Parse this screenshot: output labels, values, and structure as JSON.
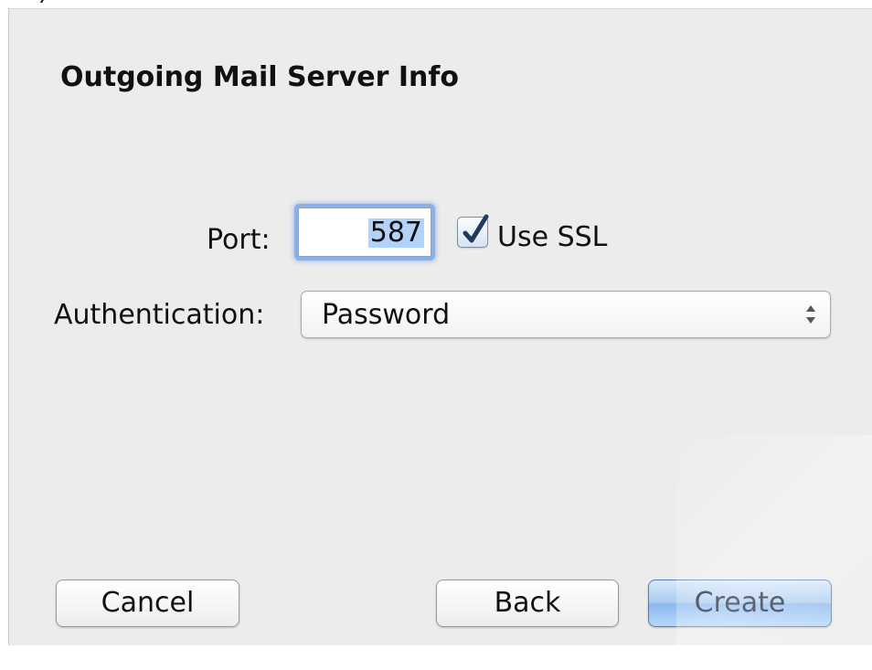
{
  "top_fragment": "… ) … … … … …",
  "dialog": {
    "title": "Outgoing Mail Server Info",
    "port": {
      "label": "Port:",
      "value": "587"
    },
    "ssl": {
      "label": "Use SSL",
      "checked": true,
      "icon": "checkmark-icon"
    },
    "authentication": {
      "label": "Authentication:",
      "selected": "Password",
      "icon": "updown-arrows-icon"
    },
    "buttons": {
      "cancel": "Cancel",
      "back": "Back",
      "create": "Create"
    }
  },
  "colors": {
    "dialog_bg": "#ececec",
    "focus_ring": "#8cb0e6",
    "selection": "#b3d2f7",
    "default_button": "#8ab8ee",
    "checkmark": "#1f3a5c"
  }
}
